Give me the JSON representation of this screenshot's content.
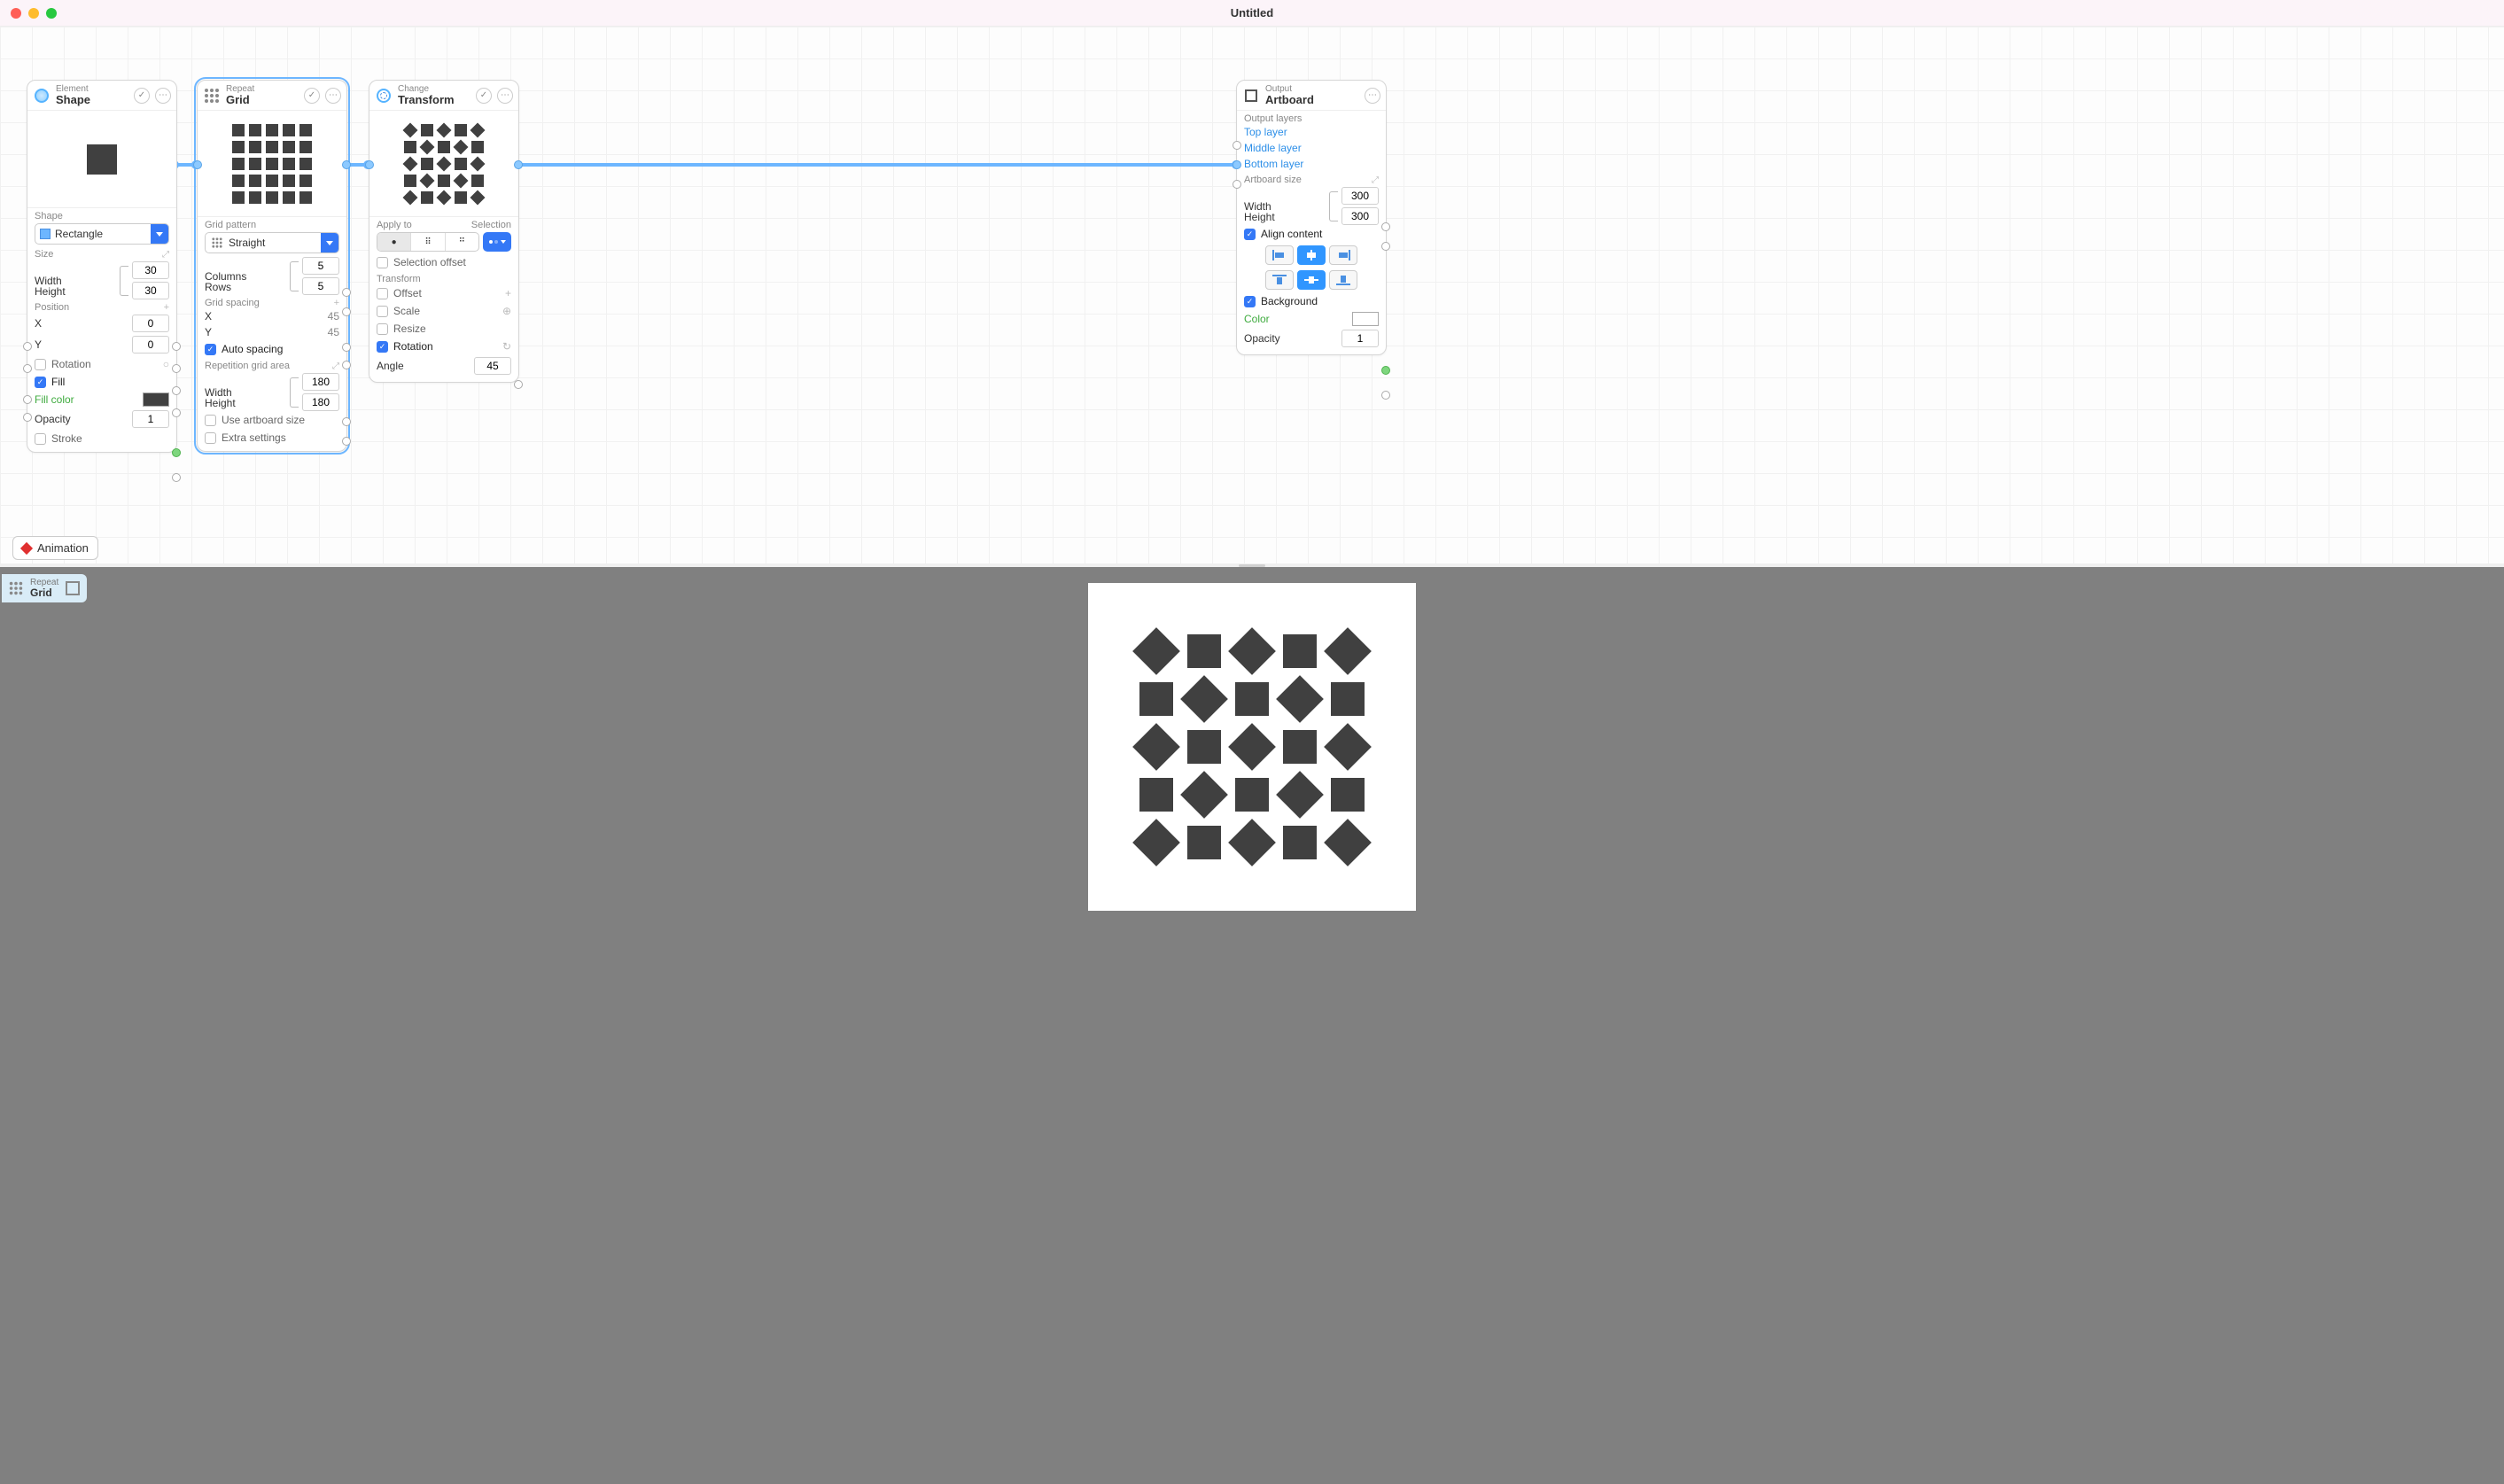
{
  "window": {
    "title": "Untitled"
  },
  "nodes": {
    "shape": {
      "category": "Element",
      "title": "Shape",
      "shape_label": "Shape",
      "shape_value": "Rectangle",
      "size_label": "Size",
      "width_label": "Width",
      "width_value": "30",
      "height_label": "Height",
      "height_value": "30",
      "position_label": "Position",
      "x_label": "X",
      "x_value": "0",
      "y_label": "Y",
      "y_value": "0",
      "rotation_label": "Rotation",
      "fill_label": "Fill",
      "fill_color_label": "Fill color",
      "opacity_label": "Opacity",
      "opacity_value": "1",
      "stroke_label": "Stroke"
    },
    "grid": {
      "category": "Repeat",
      "title": "Grid",
      "pattern_label": "Grid pattern",
      "pattern_value": "Straight",
      "columns_label": "Columns",
      "columns_value": "5",
      "rows_label": "Rows",
      "rows_value": "5",
      "spacing_label": "Grid spacing",
      "sx_label": "X",
      "sx_value": "45",
      "sy_label": "Y",
      "sy_value": "45",
      "auto_spacing_label": "Auto spacing",
      "area_label": "Repetition grid area",
      "aw_label": "Width",
      "aw_value": "180",
      "ah_label": "Height",
      "ah_value": "180",
      "use_artb_label": "Use artboard size",
      "extra_label": "Extra settings"
    },
    "transform": {
      "category": "Change",
      "title": "Transform",
      "apply_label": "Apply to",
      "selection_label": "Selection",
      "sel_offset_label": "Selection offset",
      "transform_label": "Transform",
      "offset_label": "Offset",
      "scale_label": "Scale",
      "resize_label": "Resize",
      "rotation_label": "Rotation",
      "angle_label": "Angle",
      "angle_value": "45"
    },
    "artboard": {
      "category": "Output",
      "title": "Artboard",
      "layers_label": "Output layers",
      "top_layer": "Top layer",
      "middle_layer": "Middle layer",
      "bottom_layer": "Bottom layer",
      "size_label": "Artboard size",
      "width_label": "Width",
      "width_value": "300",
      "height_label": "Height",
      "height_value": "300",
      "align_label": "Align content",
      "bg_label": "Background",
      "color_label": "Color",
      "opacity_label": "Opacity",
      "opacity_value": "1"
    }
  },
  "animation_tab": "Animation",
  "output_tab": {
    "category": "Repeat",
    "title": "Grid"
  }
}
